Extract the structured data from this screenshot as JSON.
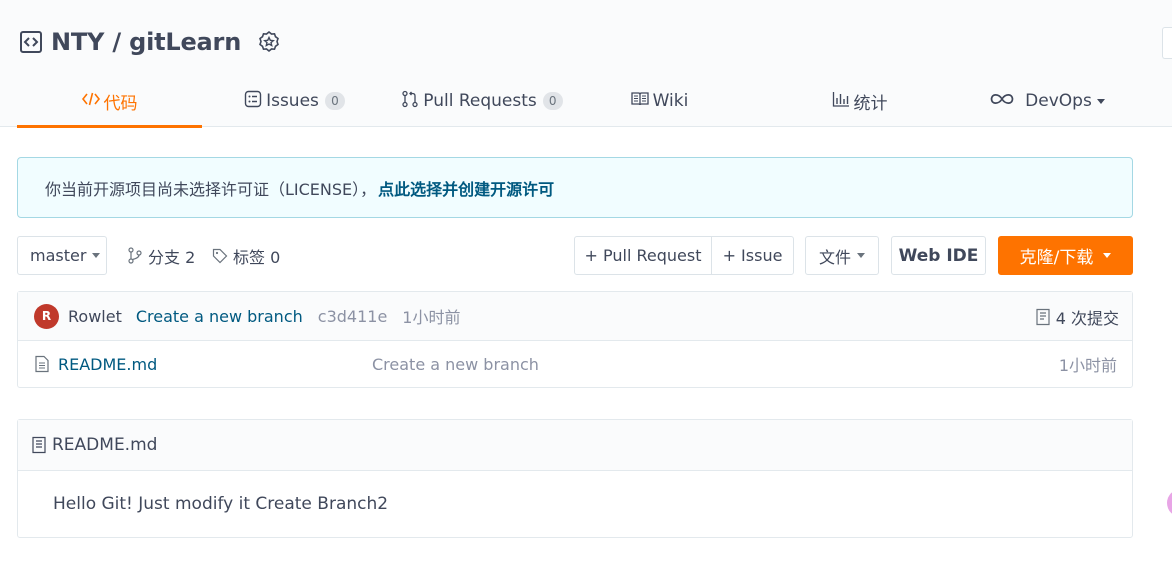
{
  "repo": {
    "title": "NTY / gitLearn"
  },
  "tabs": [
    {
      "label": "代码",
      "icon": "code-icon",
      "active": true
    },
    {
      "label": "Issues",
      "count": "0",
      "icon": "issues-icon"
    },
    {
      "label": "Pull Requests",
      "count": "0",
      "icon": "pull-request-icon"
    },
    {
      "label": "Wiki",
      "icon": "book-icon"
    },
    {
      "label": "统计",
      "icon": "bar-chart-icon"
    },
    {
      "label": "DevOps",
      "icon": "infinity-icon",
      "dropdown": true
    }
  ],
  "license_notice": {
    "text": "你当前开源项目尚未选择许可证（LICENSE），",
    "link": "点此选择并创建开源许可"
  },
  "toolbar": {
    "branch": "master",
    "branches": "分支 2",
    "tags": "标签 0",
    "new_pr": "+ Pull Request",
    "new_issue": "+ Issue",
    "files": "文件",
    "web_ide": "Web IDE",
    "clone": "克隆/下载"
  },
  "latest_commit": {
    "avatar_initial": "R",
    "author": "Rowlet",
    "message": "Create a new branch",
    "sha": "c3d411e",
    "time": "1小时前",
    "count": "4 次提交"
  },
  "files": [
    {
      "name": "README.md",
      "message": "Create a new branch",
      "time": "1小时前"
    }
  ],
  "readme": {
    "title": "README.md",
    "content": "Hello Git! Just modify it Create Branch2"
  },
  "colors": {
    "accent": "#fe7300",
    "link": "#005980",
    "notice_bg": "#f1fdff",
    "notice_border": "#a4d8e4",
    "avatar": "#c0392b"
  }
}
